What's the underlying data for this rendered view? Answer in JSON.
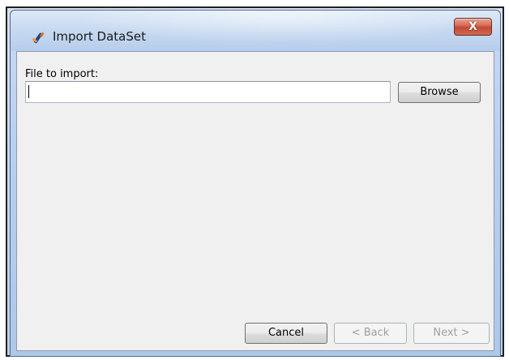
{
  "window": {
    "title": "Import DataSet",
    "close_label": "X"
  },
  "form": {
    "file_label": "File to import:",
    "file_value": "",
    "browse_label": "Browse"
  },
  "footer": {
    "cancel_label": "Cancel",
    "back_label": "< Back",
    "next_label": "Next >"
  },
  "colors": {
    "client_background": "#f0f0f0",
    "close_button": "#c44a35"
  },
  "icons": {
    "app_icon": "import-wand-icon",
    "close_icon": "close-icon"
  }
}
